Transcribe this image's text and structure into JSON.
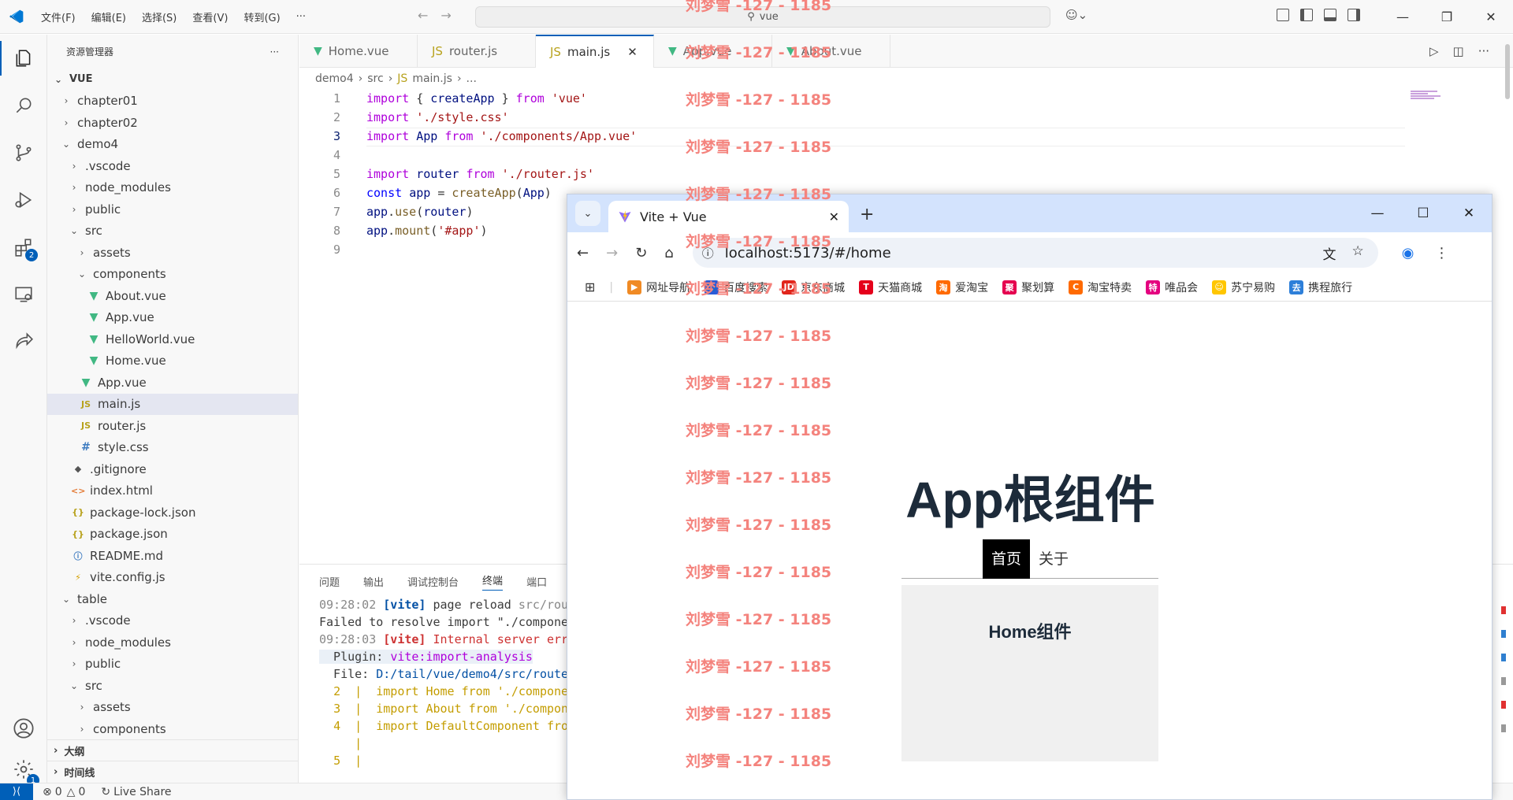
{
  "titlebar": {
    "menu": [
      "文件(F)",
      "编辑(E)",
      "选择(S)",
      "查看(V)",
      "转到(G)",
      "···"
    ],
    "search": "vue"
  },
  "sidebar": {
    "title": "资源管理器",
    "root": "VUE",
    "tree": [
      {
        "label": "chapter01",
        "depth": 1,
        "chev": "›",
        "icon": ""
      },
      {
        "label": "chapter02",
        "depth": 1,
        "chev": "›",
        "icon": ""
      },
      {
        "label": "demo4",
        "depth": 1,
        "chev": "⌄",
        "icon": ""
      },
      {
        "label": ".vscode",
        "depth": 2,
        "chev": "›",
        "icon": ""
      },
      {
        "label": "node_modules",
        "depth": 2,
        "chev": "›",
        "icon": ""
      },
      {
        "label": "public",
        "depth": 2,
        "chev": "›",
        "icon": ""
      },
      {
        "label": "src",
        "depth": 2,
        "chev": "⌄",
        "icon": ""
      },
      {
        "label": "assets",
        "depth": 3,
        "chev": "›",
        "icon": ""
      },
      {
        "label": "components",
        "depth": 3,
        "chev": "⌄",
        "icon": ""
      },
      {
        "label": "About.vue",
        "depth": 4,
        "chev": "",
        "icon": "vue"
      },
      {
        "label": "App.vue",
        "depth": 4,
        "chev": "",
        "icon": "vue"
      },
      {
        "label": "HelloWorld.vue",
        "depth": 4,
        "chev": "",
        "icon": "vue"
      },
      {
        "label": "Home.vue",
        "depth": 4,
        "chev": "",
        "icon": "vue"
      },
      {
        "label": "App.vue",
        "depth": 3,
        "chev": "",
        "icon": "vue"
      },
      {
        "label": "main.js",
        "depth": 3,
        "chev": "",
        "icon": "js",
        "selected": true
      },
      {
        "label": "router.js",
        "depth": 3,
        "chev": "",
        "icon": "js"
      },
      {
        "label": "style.css",
        "depth": 3,
        "chev": "",
        "icon": "css"
      },
      {
        "label": ".gitignore",
        "depth": 2,
        "chev": "",
        "icon": "git"
      },
      {
        "label": "index.html",
        "depth": 2,
        "chev": "",
        "icon": "html"
      },
      {
        "label": "package-lock.json",
        "depth": 2,
        "chev": "",
        "icon": "json"
      },
      {
        "label": "package.json",
        "depth": 2,
        "chev": "",
        "icon": "json"
      },
      {
        "label": "README.md",
        "depth": 2,
        "chev": "",
        "icon": "md"
      },
      {
        "label": "vite.config.js",
        "depth": 2,
        "chev": "",
        "icon": "vite"
      },
      {
        "label": "table",
        "depth": 1,
        "chev": "⌄",
        "icon": ""
      },
      {
        "label": ".vscode",
        "depth": 2,
        "chev": "›",
        "icon": ""
      },
      {
        "label": "node_modules",
        "depth": 2,
        "chev": "›",
        "icon": ""
      },
      {
        "label": "public",
        "depth": 2,
        "chev": "›",
        "icon": ""
      },
      {
        "label": "src",
        "depth": 2,
        "chev": "⌄",
        "icon": ""
      },
      {
        "label": "assets",
        "depth": 3,
        "chev": "›",
        "icon": ""
      },
      {
        "label": "components",
        "depth": 3,
        "chev": "›",
        "icon": ""
      }
    ],
    "outline": "大纲",
    "timeline": "时间线"
  },
  "activity_badges": {
    "extensions": "2",
    "settings": "1"
  },
  "tabs": [
    {
      "label": "Home.vue",
      "icon": "vue"
    },
    {
      "label": "router.js",
      "icon": "js"
    },
    {
      "label": "main.js",
      "icon": "js",
      "active": true
    },
    {
      "label": "App.vue",
      "icon": "vue"
    },
    {
      "label": "About.vue",
      "icon": "vue"
    }
  ],
  "breadcrumb": [
    "demo4",
    "src",
    "main.js",
    "..."
  ],
  "code": [
    {
      "n": "1",
      "html": "<span class='kw'>import</span> <span class='pl'>{ </span><span class='var'>createApp</span><span class='pl'> } </span><span class='kw'>from</span> <span class='str'>'vue'</span>"
    },
    {
      "n": "2",
      "html": "<span class='kw'>import</span> <span class='str'>'./style.css'</span>"
    },
    {
      "n": "3",
      "html": "<span class='kw'>import</span> <span class='var'>App</span> <span class='kw'>from</span> <span class='str'>'./components/App.vue'</span>"
    },
    {
      "n": "4",
      "html": ""
    },
    {
      "n": "5",
      "html": "<span class='kw'>import</span> <span class='var'>router</span> <span class='kw'>from</span> <span class='str'>'./router.js'</span>"
    },
    {
      "n": "6",
      "html": "<span class='kw2'>const</span> <span class='var'>app</span> <span class='pl'>= </span><span class='fn'>createApp</span><span class='pl'>(</span><span class='var'>App</span><span class='pl'>)</span>"
    },
    {
      "n": "7",
      "html": "<span class='var'>app</span><span class='pl'>.</span><span class='fn'>use</span><span class='pl'>(</span><span class='var'>router</span><span class='pl'>)</span>"
    },
    {
      "n": "8",
      "html": "<span class='var'>app</span><span class='pl'>.</span><span class='fn'>mount</span><span class='pl'>(</span><span class='str'>'#app'</span><span class='pl'>)</span>"
    },
    {
      "n": "9",
      "html": ""
    }
  ],
  "panel": {
    "tabs": [
      "问题",
      "输出",
      "调试控制台",
      "终端",
      "端口"
    ],
    "terminal": [
      {
        "html": "<span class='time'>09:28:02</span> <span class='vite'>[vite]</span> page reload <span class='time'>src/rou</span>"
      },
      {
        "html": "Failed to resolve import \"./compone"
      },
      {
        "html": "<span class='time'>09:28:03</span> <span class='viteerr'>[vite]</span> <span class='err'>Internal server err</span>"
      },
      {
        "html": "<span class='hl'>  Plugin: <span style='color:#af00db'>vite:import-analysis</span></span>"
      },
      {
        "html": "  File: <span style='color:#0451a5'>D:/tail/vue/demo4/src/route</span>"
      },
      {
        "html": "  <span class='green'>2</span>  <span class='green'>|</span>  <span class='green'>import Home from './compone</span>"
      },
      {
        "html": "  <span class='green'>3</span>  <span class='green'>|</span>  <span class='green'>import About from './compon</span>"
      },
      {
        "html": "  <span class='green'>4</span>  <span class='green'>|</span>  <span class='green'>import DefaultComponent fro</span>"
      },
      {
        "html": "     <span class='green'>|</span>"
      },
      {
        "html": "  <span class='green'>5</span>  <span class='green'>|</span>"
      }
    ]
  },
  "statusbar": {
    "errors": "0",
    "warnings": "0",
    "liveshare": "Live Share"
  },
  "browser": {
    "tab_title": "Vite + Vue",
    "url": "localhost:5173/#/home",
    "bookmarks": [
      {
        "label": "网址导航",
        "color": "#f08a24",
        "glyph": "▶"
      },
      {
        "label": "百度搜索",
        "color": "#2a5bd7",
        "glyph": "🐾"
      },
      {
        "label": "京东商城",
        "color": "#e1251b",
        "glyph": "JD"
      },
      {
        "label": "天猫商城",
        "color": "#e5001b",
        "glyph": "T"
      },
      {
        "label": "爱淘宝",
        "color": "#ff6a00",
        "glyph": "淘"
      },
      {
        "label": "聚划算",
        "color": "#e5004f",
        "glyph": "聚"
      },
      {
        "label": "淘宝特卖",
        "color": "#ff6a00",
        "glyph": "C"
      },
      {
        "label": "唯品会",
        "color": "#e4007f",
        "glyph": "特"
      },
      {
        "label": "苏宁易购",
        "color": "#ffc600",
        "glyph": "☺"
      },
      {
        "label": "携程旅行",
        "color": "#2d7fd9",
        "glyph": "去"
      }
    ],
    "app": {
      "title": "App根组件",
      "nav": [
        "首页",
        "关于"
      ],
      "home": "Home组件"
    }
  },
  "watermark": "刘梦雪 -127 - 1185"
}
